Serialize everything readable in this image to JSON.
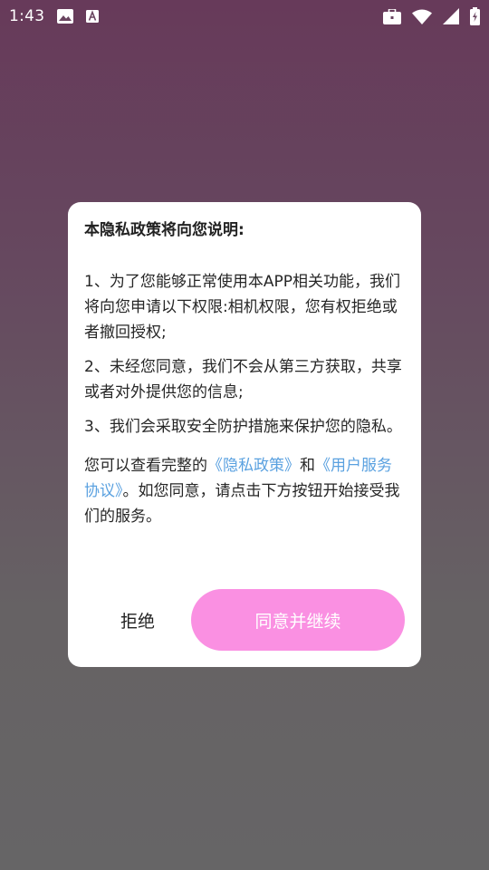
{
  "status_bar": {
    "time": "1:43",
    "left_icons": [
      "image-icon",
      "text-a-icon"
    ],
    "right_icons": [
      "briefcase-icon",
      "wifi-icon",
      "signal-icon",
      "battery-icon"
    ]
  },
  "dialog": {
    "title": "本隐私政策将向您说明:",
    "item1": "1、为了您能够正常使用本APP相关功能，我们将向您申请以下权限:相机权限，您有权拒绝或者撤回授权;",
    "item2": "2、未经您同意，我们不会从第三方获取，共享或者对外提供您的信息;",
    "item3": "3、我们会采取安全防护措施来保护您的隐私。",
    "note_prefix": "您可以查看完整的",
    "privacy_link": "《隐私政策》",
    "note_and": "和",
    "terms_link": "《用户服务协议》",
    "note_suffix": "。如您同意，请点击下方按钮开始接受我们的服务。",
    "reject_label": "拒绝",
    "agree_label": "同意并继续"
  },
  "colors": {
    "link": "#5aa1e0",
    "agree_button": "#fa90e2"
  }
}
